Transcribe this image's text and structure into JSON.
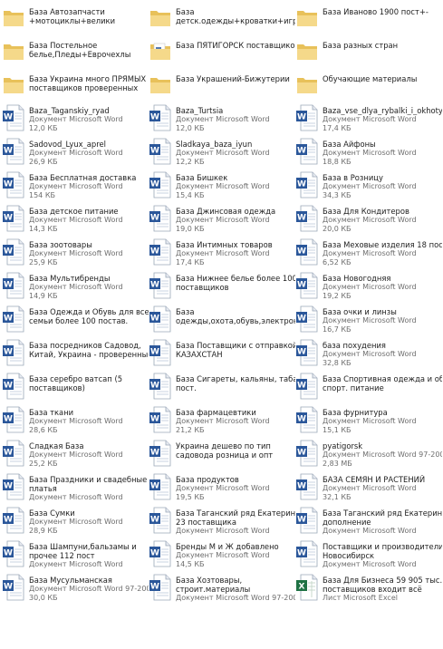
{
  "colors": {
    "folder_back": "#e8c15a",
    "folder_front": "#f5d98a",
    "word_blue": "#2b579a",
    "excel_green": "#1f7244"
  },
  "items": [
    {
      "type": "folder",
      "icon": "folder-icon",
      "lines": [
        "База Автозапчасти",
        "+мотоциклы+велики"
      ]
    },
    {
      "type": "folder",
      "icon": "folder-icon",
      "lines": [
        "База",
        "детск.одежды+кроватки+игруш..."
      ]
    },
    {
      "type": "folder",
      "icon": "folder-icon",
      "lines": [
        "База Иваново 1900 пост+-"
      ]
    },
    {
      "type": "folder",
      "icon": "folder-icon",
      "lines": [
        "База Постельное",
        "белье,Пледы+Еврочехлы"
      ]
    },
    {
      "type": "folder",
      "icon": "folder-doc-icon",
      "lines": [
        "База ПЯТИГОРСК поставщиков"
      ]
    },
    {
      "type": "folder",
      "icon": "folder-icon",
      "lines": [
        "База разных стран"
      ]
    },
    {
      "type": "folder",
      "icon": "folder-icon",
      "lines": [
        "База Украина много ПРЯМЫХ",
        "поставщиков проверенных"
      ]
    },
    {
      "type": "folder",
      "icon": "folder-icon",
      "lines": [
        "База Украшений-Бижутерии"
      ]
    },
    {
      "type": "folder",
      "icon": "folder-icon",
      "lines": [
        "Обучающие материалы"
      ]
    },
    {
      "type": "word",
      "lines": [
        "Baza_Taganskiy_ryad",
        "Документ Microsoft Word",
        "12,0 КБ"
      ]
    },
    {
      "type": "word",
      "lines": [
        "Baza_Turtsia",
        "Документ Microsoft Word",
        "12,0 КБ"
      ]
    },
    {
      "type": "word",
      "lines": [
        "Baza_vse_dlya_rybalki_i_okhoty",
        "Документ Microsoft Word",
        "17,4 КБ"
      ]
    },
    {
      "type": "word",
      "lines": [
        "Sadovod_Lyux_aprel",
        "Документ Microsoft Word",
        "26,9 КБ"
      ]
    },
    {
      "type": "word",
      "lines": [
        "Sladkaya_baza_iyun",
        "Документ Microsoft Word",
        "12,2 КБ"
      ]
    },
    {
      "type": "word",
      "lines": [
        "База Айфоны",
        "Документ Microsoft Word",
        "18,8 КБ"
      ]
    },
    {
      "type": "word",
      "lines": [
        "База Бесплатная доставка",
        "Документ Microsoft Word",
        "154 КБ"
      ]
    },
    {
      "type": "word",
      "lines": [
        "База Бишкек",
        "Документ Microsoft Word",
        "15,4 КБ"
      ]
    },
    {
      "type": "word",
      "lines": [
        "База в Розницу",
        "Документ Microsoft Word",
        "34,3 КБ"
      ]
    },
    {
      "type": "word",
      "lines": [
        "База детское питание",
        "Документ Microsoft Word",
        "14,3 КБ"
      ]
    },
    {
      "type": "word",
      "lines": [
        "База Джинсовая одежда",
        "Документ Microsoft Word",
        "19,0 КБ"
      ]
    },
    {
      "type": "word",
      "lines": [
        "База Для Кондитеров",
        "Документ Microsoft Word",
        "20,0 КБ"
      ]
    },
    {
      "type": "word",
      "lines": [
        "База зоотовары",
        "Документ Microsoft Word",
        "25,9 КБ"
      ]
    },
    {
      "type": "word",
      "lines": [
        "База Интимных товаров",
        "Документ Microsoft Word",
        "17,4 КБ"
      ]
    },
    {
      "type": "word",
      "lines": [
        "База Меховые изделия 18 пост",
        "Документ Microsoft Word",
        "6,52 КБ"
      ]
    },
    {
      "type": "word",
      "lines": [
        "База Мультибренды",
        "Документ Microsoft Word",
        "14,9 КБ"
      ]
    },
    {
      "type": "word",
      "lines": [
        "База Нижнее белье более 100",
        "поставщиков"
      ]
    },
    {
      "type": "word",
      "lines": [
        "База Новогодняя",
        "Документ Microsoft Word",
        "19,2 КБ"
      ]
    },
    {
      "type": "word",
      "lines": [
        "База Одежда и Обувь для всей",
        "семьи более 100 постав."
      ]
    },
    {
      "type": "word",
      "lines": [
        "База",
        "одежды,охота,обувь,электроник..."
      ]
    },
    {
      "type": "word",
      "lines": [
        "База очки и линзы",
        "Документ Microsoft Word",
        "16,7 КБ"
      ]
    },
    {
      "type": "word",
      "lines": [
        "База посредников Садовод,",
        "Китай, Украина - проверенные"
      ]
    },
    {
      "type": "word",
      "lines": [
        "База Поставщики с отправкой в",
        "КАЗАХСТАН"
      ]
    },
    {
      "type": "word",
      "lines": [
        "база похудения",
        "Документ Microsoft Word",
        "32,8 КБ"
      ]
    },
    {
      "type": "word",
      "lines": [
        "База серебро ватсап (5",
        "поставщиков)"
      ]
    },
    {
      "type": "word",
      "lines": [
        "База Сигареты, кальяны, табак 61",
        "пост."
      ]
    },
    {
      "type": "word",
      "lines": [
        "База Спортивная одежда и обувь,",
        "спорт. питание"
      ]
    },
    {
      "type": "word",
      "lines": [
        "База ткани",
        "Документ Microsoft Word",
        "28,6 КБ"
      ]
    },
    {
      "type": "word",
      "lines": [
        "База фармацевтики",
        "Документ Microsoft Word",
        "21,2 КБ"
      ]
    },
    {
      "type": "word",
      "lines": [
        "База фурнитура",
        "Документ Microsoft Word",
        "15,1 КБ"
      ]
    },
    {
      "type": "word",
      "lines": [
        "Сладкая База",
        "Документ Microsoft Word",
        "25,2 КБ"
      ]
    },
    {
      "type": "word",
      "lines": [
        "Украина дешево по тип",
        "садовода розница и опт"
      ]
    },
    {
      "type": "word",
      "lines": [
        "pyatigorsk",
        "Документ Microsoft Word 97-2003",
        "2,83 МБ"
      ]
    },
    {
      "type": "word",
      "lines": [
        "База Праздники и свадебные",
        "платья",
        "Документ Microsoft Word"
      ]
    },
    {
      "type": "word",
      "lines": [
        "База продуктов",
        "Документ Microsoft Word",
        "19,5 КБ"
      ]
    },
    {
      "type": "word",
      "lines": [
        "БАЗА СЕМЯН И РАСТЕНИЙ",
        "Документ Microsoft Word",
        "32,1 КБ"
      ]
    },
    {
      "type": "word",
      "lines": [
        "База Сумки",
        "Документ Microsoft Word",
        "28,9 КБ"
      ]
    },
    {
      "type": "word",
      "lines": [
        "База Таганский ряд Екатеринбург",
        "23 поставщика",
        "Документ Microsoft Word"
      ]
    },
    {
      "type": "word",
      "lines": [
        "База Таганский ряд Екатеринбург",
        "дополнение",
        "Документ Microsoft Word"
      ]
    },
    {
      "type": "word",
      "lines": [
        "База Шампуни,бальзамы и",
        "прочее 112 пост",
        "Документ Microsoft Word"
      ]
    },
    {
      "type": "word",
      "lines": [
        "Бренды М и Ж добавлено",
        "Документ Microsoft Word",
        "14,5 КБ"
      ]
    },
    {
      "type": "word",
      "lines": [
        "Поставщики и производители",
        "Новосибирск",
        "Документ Microsoft Word"
      ]
    },
    {
      "type": "word",
      "lines": [
        "База Мусульманская",
        "Документ Microsoft Word 97-2003",
        "30,0 КБ"
      ]
    },
    {
      "type": "word",
      "lines": [
        "База Хозтовары,",
        "строит.материалы",
        "Документ Microsoft Word 97-2003"
      ]
    },
    {
      "type": "excel",
      "lines": [
        "База Для Бизнеса 59 905 тыс.",
        "поставщиков входит всё",
        "Лист Microsoft Excel"
      ]
    }
  ]
}
